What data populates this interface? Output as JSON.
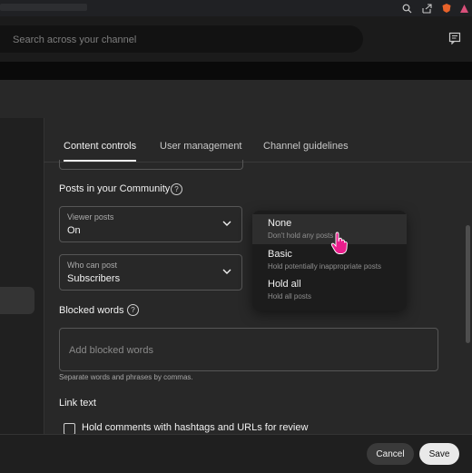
{
  "search": {
    "placeholder": "Search across your channel"
  },
  "tabs": [
    {
      "label": "Content controls",
      "active": true
    },
    {
      "label": "User management",
      "active": false
    },
    {
      "label": "Channel guidelines",
      "active": false
    }
  ],
  "posts_section": {
    "title": "Posts in your Community",
    "viewer_posts": {
      "label": "Viewer posts",
      "value": "On"
    },
    "who_can_post": {
      "label": "Who can post",
      "value": "Subscribers"
    }
  },
  "dropdown": {
    "options": [
      {
        "label": "None",
        "description": "Don't hold any posts"
      },
      {
        "label": "Basic",
        "description": "Hold potentially inappropriate posts"
      },
      {
        "label": "Hold all",
        "description": "Hold all posts"
      }
    ]
  },
  "blocked_words": {
    "title": "Blocked words",
    "placeholder": "Add blocked words",
    "hint": "Separate words and phrases by commas."
  },
  "link_text": {
    "title": "Link text",
    "checkbox_label": "Hold comments with hashtags and URLs for review"
  },
  "footer": {
    "cancel_label": "Cancel",
    "save_label": "Save"
  },
  "colors": {
    "accent_cursor": "#e91e8c",
    "save_button": "#e9e9e9"
  }
}
